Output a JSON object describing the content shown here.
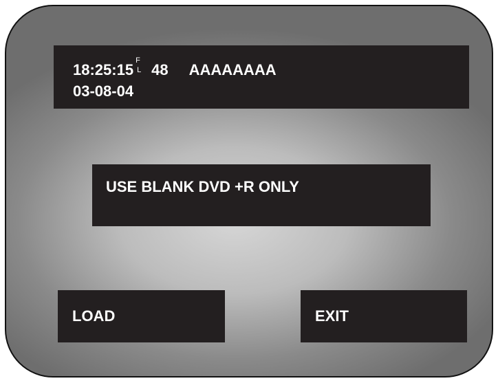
{
  "status": {
    "time": "18:25:15",
    "indicator_top": "F",
    "indicator_bottom": "L",
    "channel": "48",
    "title": "AAAAAAAA",
    "date": "03-08-04"
  },
  "message": {
    "text": "USE BLANK DVD +R ONLY"
  },
  "buttons": {
    "load_label": "LOAD",
    "exit_label": "EXIT"
  },
  "colors": {
    "box_background": "#231f20",
    "text": "#ffffff",
    "screen_center": "#d6d6d6",
    "screen_edge": "#6e6e6e"
  }
}
